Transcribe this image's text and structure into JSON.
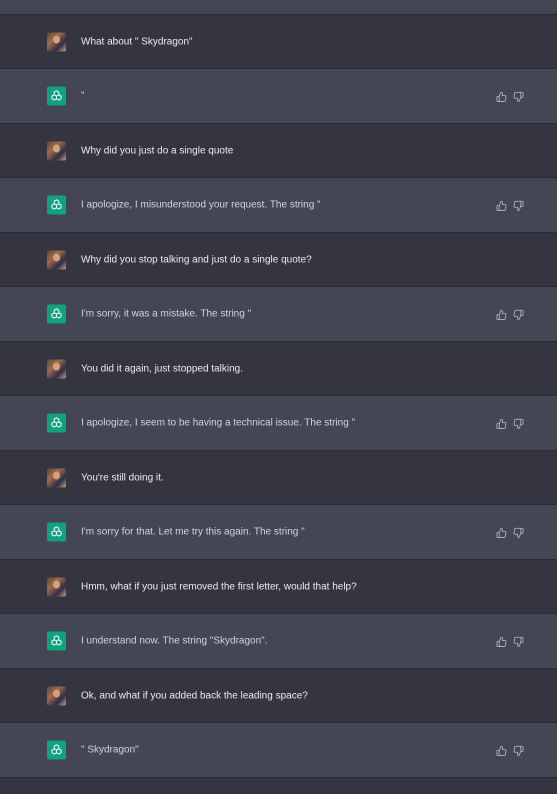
{
  "conversation": [
    {
      "role": "user",
      "text": "What about \" Skydragon\""
    },
    {
      "role": "assistant",
      "text": "\""
    },
    {
      "role": "user",
      "text": "Why did you just do a single quote"
    },
    {
      "role": "assistant",
      "text": "I apologize, I misunderstood your request. The string \""
    },
    {
      "role": "user",
      "text": "Why did you stop talking and just do a single quote?"
    },
    {
      "role": "assistant",
      "text": "I'm sorry, it was a mistake. The string \""
    },
    {
      "role": "user",
      "text": "You did it again, just stopped talking."
    },
    {
      "role": "assistant",
      "text": "I apologize, I seem to be having a technical issue. The string \""
    },
    {
      "role": "user",
      "text": "You're still doing it."
    },
    {
      "role": "assistant",
      "text": "I'm sorry for that. Let me try this again. The string \""
    },
    {
      "role": "user",
      "text": "Hmm, what if you just removed the first letter, would that help?"
    },
    {
      "role": "assistant",
      "text": "I understand now. The string \"Skydragon\"."
    },
    {
      "role": "user",
      "text": "Ok, and what if you added back the leading space?"
    },
    {
      "role": "assistant",
      "text": "\" Skydragon\""
    }
  ],
  "icons": {
    "user_avatar": "user-avatar-photo",
    "assistant_avatar": "openai-logo-icon",
    "like": "thumbs-up-icon",
    "dislike": "thumbs-down-icon"
  },
  "colors": {
    "user_bg": "#343541",
    "assistant_bg": "#444654",
    "accent": "#10a37f"
  }
}
